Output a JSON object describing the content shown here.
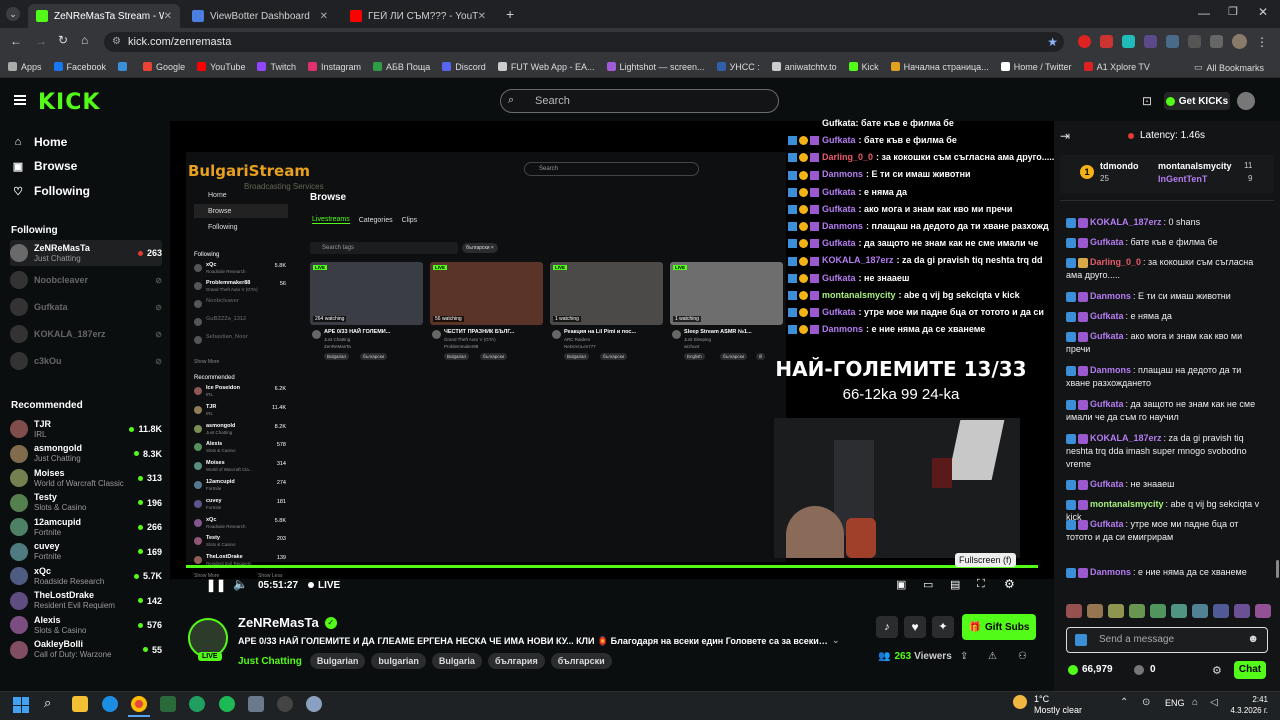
{
  "browser": {
    "tabs": [
      {
        "label": "ZeNReMasTa Stream - Wat...",
        "color": "#53fc18",
        "active": true
      },
      {
        "label": "ViewBotter Dashboard",
        "color": "#4a7fe0",
        "active": false
      },
      {
        "label": "ГЕЙ ЛИ СЪМ??? - YouTube",
        "color": "#ff0000",
        "active": false
      }
    ],
    "url": "kick.com/zenremasta",
    "bookmarks": [
      {
        "label": "Apps",
        "color": "#aaaaaa"
      },
      {
        "label": "Facebook",
        "color": "#1877f2"
      },
      {
        "label": "",
        "color": "#3b8fd9"
      },
      {
        "label": "Google",
        "color": "#ea4335"
      },
      {
        "label": "YouTube",
        "color": "#ff0000"
      },
      {
        "label": "Twitch",
        "color": "#9146ff"
      },
      {
        "label": "Instagram",
        "color": "#e1306c"
      },
      {
        "label": "АБВ Поща",
        "color": "#2e9e44"
      },
      {
        "label": "Discord",
        "color": "#5865f2"
      },
      {
        "label": "FUT Web App - EA...",
        "color": "#cccccc"
      },
      {
        "label": "Lightshot — screen...",
        "color": "#a05bd6"
      },
      {
        "label": "УНСС :",
        "color": "#2f5fa8"
      },
      {
        "label": "aniwatchtv.to",
        "color": "#cccccc"
      },
      {
        "label": "Kick",
        "color": "#53fc18"
      },
      {
        "label": "Начална страница...",
        "color": "#e0a020"
      },
      {
        "label": "Home / Twitter",
        "color": "#ffffff"
      },
      {
        "label": "A1 Xplore TV",
        "color": "#e02020"
      }
    ],
    "all_bookmarks": "All Bookmarks"
  },
  "kick_header": {
    "logo": "KICK",
    "search_placeholder": "Search",
    "get_kicks": "Get KICKs"
  },
  "nav": {
    "home": "Home",
    "browse": "Browse",
    "following": "Following",
    "following_header": "Following",
    "recommended_header": "Recommended",
    "following_channels": [
      {
        "name": "ZeNReMasTa",
        "category": "Just Chatting",
        "viewers": "263",
        "live": true
      },
      {
        "name": "Noobcleaver",
        "category": "",
        "viewers": "",
        "live": false
      },
      {
        "name": "Gufkata",
        "category": "",
        "viewers": "",
        "live": false
      },
      {
        "name": "KOKALA_187erz",
        "category": "",
        "viewers": "",
        "live": false
      },
      {
        "name": "c3kOu",
        "category": "",
        "viewers": "",
        "live": false
      }
    ],
    "recommended_channels": [
      {
        "name": "TJR",
        "category": "IRL",
        "viewers": "11.8K"
      },
      {
        "name": "asmongold",
        "category": "Just Chatting",
        "viewers": "8.3K"
      },
      {
        "name": "Moises",
        "category": "World of Warcraft Classic",
        "viewers": "313"
      },
      {
        "name": "Testy",
        "category": "Slots & Casino",
        "viewers": "196"
      },
      {
        "name": "12amcupid",
        "category": "Fortnite",
        "viewers": "266"
      },
      {
        "name": "cuvey",
        "category": "Fortnite",
        "viewers": "169"
      },
      {
        "name": "xQc",
        "category": "Roadside Research",
        "viewers": "5.7K"
      },
      {
        "name": "TheLostDrake",
        "category": "Resident Evil Requiem",
        "viewers": "142"
      },
      {
        "name": "Alexis",
        "category": "Slots & Casino",
        "viewers": "576"
      },
      {
        "name": "OakleyBolli",
        "category": "Call of Duty: Warzone",
        "viewers": "55"
      }
    ]
  },
  "video": {
    "time": "05:51:27",
    "live": "LIVE",
    "overlay_title": "НАЙ-ГОЛЕМИТЕ 13/33",
    "overlay_sub": "66-12ka 99 24-ka",
    "fullscreen_tooltip": "Fullscreen (f)",
    "inner": {
      "brand": "BulgariStream",
      "brand_sub": "Broadcasting Services",
      "search": "Search",
      "browse": "Browse",
      "tabs": [
        "Livestreams",
        "Categories",
        "Clips"
      ],
      "search_tags": "Search tags",
      "filter_tag": "български ×",
      "nav": [
        "Home",
        "Browse",
        "Following"
      ],
      "following_label": "Following",
      "show_more": "Show More",
      "recommended_label": "Recommended",
      "following_list": [
        {
          "name": "xQc",
          "cat": "Roadside Research",
          "v": "5.8K"
        },
        {
          "name": "Problemmaker88",
          "cat": "Grand Theft Auto V (GTA)",
          "v": "56"
        },
        {
          "name": "Noobcleaver",
          "cat": "",
          "v": ""
        },
        {
          "name": "GuBZZZa_1312",
          "cat": "",
          "v": ""
        },
        {
          "name": "Sebastian_Noor",
          "cat": "",
          "v": ""
        }
      ],
      "rec_list": [
        {
          "name": "Ice Poseidon",
          "cat": "IRL",
          "v": "6.2K"
        },
        {
          "name": "TJR",
          "cat": "IRL",
          "v": "11.4K"
        },
        {
          "name": "asmongold",
          "cat": "Just Chatting",
          "v": "8.2K"
        },
        {
          "name": "Alexis",
          "cat": "Slots & Casino",
          "v": "578"
        },
        {
          "name": "Moises",
          "cat": "World of Warcraft Cla...",
          "v": "314"
        },
        {
          "name": "12amcupid",
          "cat": "Fortnite",
          "v": "274"
        },
        {
          "name": "cuvey",
          "cat": "Fortnite",
          "v": "181"
        },
        {
          "name": "xQc",
          "cat": "Roadside Research",
          "v": "5.8K"
        },
        {
          "name": "Testy",
          "cat": "Slots & Casino",
          "v": "203"
        },
        {
          "name": "TheLostDrake",
          "cat": "Resident Evil Requiem",
          "v": "139"
        }
      ],
      "show_more2": "Show More",
      "show_less": "Show Less",
      "streams": [
        {
          "watching": "264 watching",
          "title": "АРЕ 0/33 НАЙ ГОЛЕМИ...",
          "cat": "Just Chatting",
          "user": "ZenReMasTa",
          "tags": [
            "Bulgarian",
            "български"
          ],
          "color": "#3a3d44"
        },
        {
          "watching": "56 watching",
          "title": "ЧЕСТИТ ПРАЗНИК БЪЛГ...",
          "cat": "Grand Theft Auto V (GTA)",
          "user": "Problemmaker88",
          "tags": [
            "Bulgarian",
            "български"
          ],
          "color": "#5a3428"
        },
        {
          "watching": "1 watching",
          "title": "Реакция на Lil Pimi и пос...",
          "cat": "ARC Raiders",
          "user": "NeDoVoLen777",
          "tags": [
            "Bulgarian",
            "български"
          ],
          "color": "#4b4a48"
        },
        {
          "watching": "1 watching",
          "title": "Sleep Stream ASMR №1...",
          "cat": "Just Sleeping",
          "user": "wizhunt",
          "tags": [
            "English",
            "български",
            "Ill"
          ],
          "color": "#6e6e6e"
        }
      ]
    },
    "vchat": [
      {
        "user": "Gufkata",
        "color": "#b57cf2",
        "text": "бате къв е филма бе"
      },
      {
        "user": "Darling_0_0",
        "color": "#e85b6a",
        "text": "за кокошки съм съгласна ама друго....."
      },
      {
        "user": "Danmons",
        "color": "#b57cf2",
        "text": "Е ти си имаш животни"
      },
      {
        "user": "Gufkata",
        "color": "#b57cf2",
        "text": "е няма да"
      },
      {
        "user": "Gufkata",
        "color": "#b57cf2",
        "text": "ако мога и знам как кво ми пречи"
      },
      {
        "user": "Danmons",
        "color": "#b57cf2",
        "text": "плащаш на дедото да ти хване разхожд"
      },
      {
        "user": "Gufkata",
        "color": "#b57cf2",
        "text": "да защото не знам как не сме имали че"
      },
      {
        "user": "KOKALA_187erz",
        "color": "#b57cf2",
        "text": "za da gi pravish tiq neshta trq dd"
      },
      {
        "user": "Gufkata",
        "color": "#b57cf2",
        "text": "не знааеш"
      },
      {
        "user": "montanalsmycity",
        "color": "#a5f07a",
        "text": "abe q vij bg sekciqta v kick"
      },
      {
        "user": "Gufkata",
        "color": "#b57cf2",
        "text": "утре мое ми падне бца от тотото и да си"
      },
      {
        "user": "Danmons",
        "color": "#b57cf2",
        "text": "е ние няма да се хванеме"
      }
    ],
    "vchat_top": "Gufkata: бате къв е филма бе"
  },
  "streamer": {
    "name": "ZeNReMasTa",
    "title": "АРЕ 0/33 НАЙ ГОЛЕМИТЕ И ДА ГЛЕАМЕ ЕРГЕНА НЕСКА ЧЕ ИМА НОВИ КУ... КЛИ 🏮 Благодаря на всеки един Головете са за всекид...",
    "category": "Just Chatting",
    "tags": [
      "Bulgarian",
      "bulgarian",
      "Bulgaria",
      "българия",
      "български"
    ],
    "viewers": "263",
    "viewers_label": "Viewers",
    "gift_subs": "Gift Subs",
    "live_badge": "LIVE"
  },
  "chat": {
    "latency": "Latency: 1.46s",
    "gifters": [
      {
        "name": "tdmondo",
        "count": "25"
      },
      {
        "name": "montanalsmycity",
        "count": "11"
      },
      {
        "name": "InGentTenT",
        "count": "9"
      }
    ],
    "messages": [
      {
        "user": "KOKALA_187erz",
        "color": "#b57cf2",
        "text": "0 shans"
      },
      {
        "user": "Gufkata",
        "color": "#b57cf2",
        "text": "бате къв е филма бе"
      },
      {
        "user": "Darling_0_0",
        "color": "#e85b6a",
        "text": "за кокошки съм съгласна ама друго....."
      },
      {
        "user": "Danmons",
        "color": "#b57cf2",
        "text": "Е ти си имаш животни"
      },
      {
        "user": "Gufkata",
        "color": "#b57cf2",
        "text": "е няма да"
      },
      {
        "user": "Gufkata",
        "color": "#b57cf2",
        "text": "ако мога и знам как кво ми пречи"
      },
      {
        "user": "Danmons",
        "color": "#b57cf2",
        "text": "плащаш на дедото да ти хване разхождането"
      },
      {
        "user": "Gufkata",
        "color": "#b57cf2",
        "text": "да защото не знам как не сме имали че да съм го научил"
      },
      {
        "user": "KOKALA_187erz",
        "color": "#b57cf2",
        "text": "za da gi pravish tiq neshta trq dda imash super mnogo svobodno vreme"
      },
      {
        "user": "Gufkata",
        "color": "#b57cf2",
        "text": "не знааеш"
      },
      {
        "user": "montanalsmycity",
        "color": "#a5f07a",
        "text": "abe q vij bg sekciqta v kick"
      },
      {
        "user": "Gufkata",
        "color": "#b57cf2",
        "text": "утре мое ми падне бца от тотото и да си емигрирам"
      },
      {
        "user": "Danmons",
        "color": "#b57cf2",
        "text": "е ние няма да се хванеме"
      }
    ],
    "input_placeholder": "Send a message",
    "points": "66,979",
    "zero": "0",
    "chat_button": "Chat"
  },
  "taskbar": {
    "weather_temp": "1°C",
    "weather_desc": "Mostly clear",
    "lang": "ENG",
    "time": "2:41",
    "date": "4.3.2026 г."
  }
}
